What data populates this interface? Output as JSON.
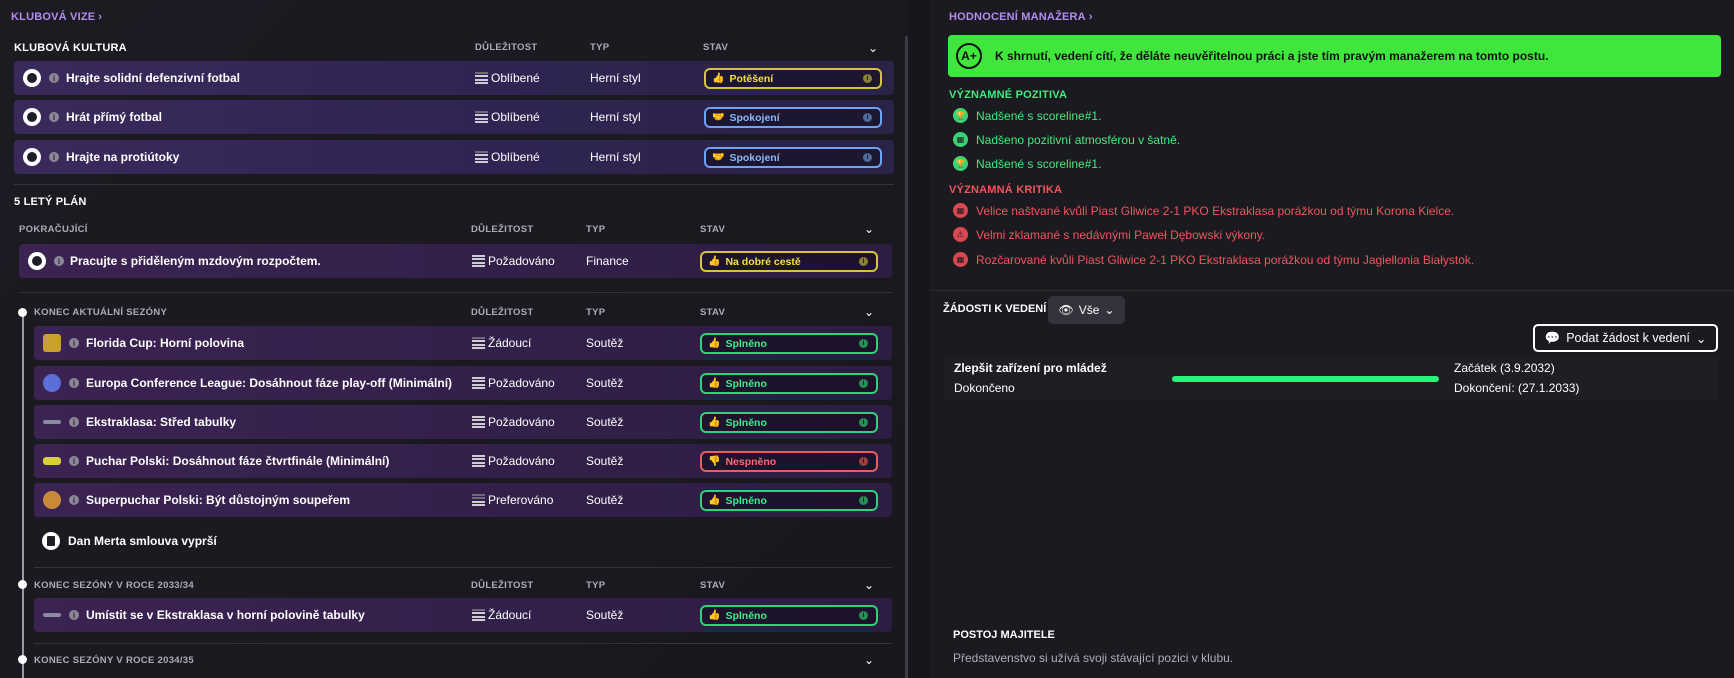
{
  "left": {
    "club_vision_link": "KLUBOVÁ VIZE",
    "club_culture": {
      "title": "KLUBOVÁ KULTURA",
      "columns": {
        "importance": "DŮLEŽITOST",
        "type": "TYP",
        "status": "STAV"
      },
      "rows": [
        {
          "title": "Hrajte solidní defenzivní fotbal",
          "importance": "Oblíbené",
          "type": "Herní styl",
          "status": "Potěšení"
        },
        {
          "title": "Hrát přímý fotbal",
          "importance": "Oblíbené",
          "type": "Herní styl",
          "status": "Spokojení"
        },
        {
          "title": "Hrajte na protiútoky",
          "importance": "Oblíbené",
          "type": "Herní styl",
          "status": "Spokojení"
        }
      ]
    },
    "five_year_plan": {
      "title": "5 LETÝ PLÁN",
      "ongoing": {
        "title": "POKRAČUJÍCÍ",
        "columns": {
          "importance": "DŮLEŽITOST",
          "type": "TYP",
          "status": "STAV"
        },
        "rows": [
          {
            "title": "Pracujte s přiděleným mzdovým rozpočtem.",
            "importance": "Požadováno",
            "type": "Finance",
            "status": "Na dobré cestě"
          }
        ]
      },
      "end_current": {
        "title": "KONEC AKTUÁLNÍ SEZÓNY",
        "columns": {
          "importance": "DŮLEŽITOST",
          "type": "TYP",
          "status": "STAV"
        },
        "rows": [
          {
            "title": "Florida Cup: Horní polovina",
            "importance": "Žádoucí",
            "type": "Soutěž",
            "status": "Splněno"
          },
          {
            "title": "Europa Conference League: Dosáhnout fáze play-off (Minimální)",
            "importance": "Požadováno",
            "type": "Soutěž",
            "status": "Splněno"
          },
          {
            "title": "Ekstraklasa: Střed tabulky",
            "importance": "Požadováno",
            "type": "Soutěž",
            "status": "Splněno"
          },
          {
            "title": "Puchar Polski: Dosáhnout fáze čtvrtfinále (Minimální)",
            "importance": "Požadováno",
            "type": "Soutěž",
            "status": "Nespněno"
          },
          {
            "title": "Superpuchar Polski: Být důstojným soupeřem",
            "importance": "Preferováno",
            "type": "Soutěž",
            "status": "Splněno"
          }
        ],
        "contract_note": "Dan Merta smlouva vyprší"
      },
      "end_2033": {
        "title": "KONEC SEZÓNY V ROCE 2033/34",
        "columns": {
          "importance": "DŮLEŽITOST",
          "type": "TYP",
          "status": "STAV"
        },
        "rows": [
          {
            "title": "Umístit se v Ekstraklasa v horní polovině tabulky",
            "importance": "Žádoucí",
            "type": "Soutěž",
            "status": "Splněno"
          }
        ]
      },
      "end_2034": {
        "title": "KONEC SEZÓNY V ROCE 2034/35"
      }
    }
  },
  "right": {
    "manager_eval_link": "HODNOCENÍ MANAŽERA",
    "grade": "A+",
    "summary": "K shrnutí, vedení cítí, že děláte neuvěřitelnou práci a jste tím pravým manažerem na tomto postu.",
    "positives_title": "VÝZNAMNÉ POZITIVA",
    "positives": [
      "Nadšené s scoreline#1.",
      "Nadšeno pozitivní atmosférou v šatně.",
      "Nadšené s scoreline#1."
    ],
    "criticism_title": "VÝZNAMNÁ KRITIKA",
    "criticism": [
      "Velice naštvané kvůli Piast Gliwice 2-1 PKO Ekstraklasa porážkou od týmu Korona Kielce.",
      "Velmi zklamané s nedávnými Paweł Dębowski výkony.",
      "Rozčarované kvůli Piast Gliwice 2-1 PKO Ekstraklasa porážkou od týmu Jagiellonia Białystok."
    ],
    "requests": {
      "title": "ŽÁDOSTI K VEDENÍ",
      "filter": "Vše",
      "submit": "Podat žádost k vedení",
      "items": [
        {
          "name": "Zlepšit zařízení pro mládež",
          "state": "Dokončeno",
          "start": "Začátek (3.9.2032)",
          "end": "Dokončení: (27.1.2033)",
          "progress": 1.0
        }
      ]
    },
    "owner": {
      "title": "POSTOJ MAJITELE",
      "text": "Představenstvo si užívá svoji stávající pozici v klubu."
    }
  },
  "colors": {
    "accent_purple": "#b38cf0",
    "grade_green": "#3fe63c",
    "positive": "#47e87c",
    "negative": "#f0545d",
    "status_green": "#39f08c",
    "status_yellow": "#f0e04a",
    "status_blue": "#8cbaf9",
    "status_red": "#ff6a70"
  }
}
